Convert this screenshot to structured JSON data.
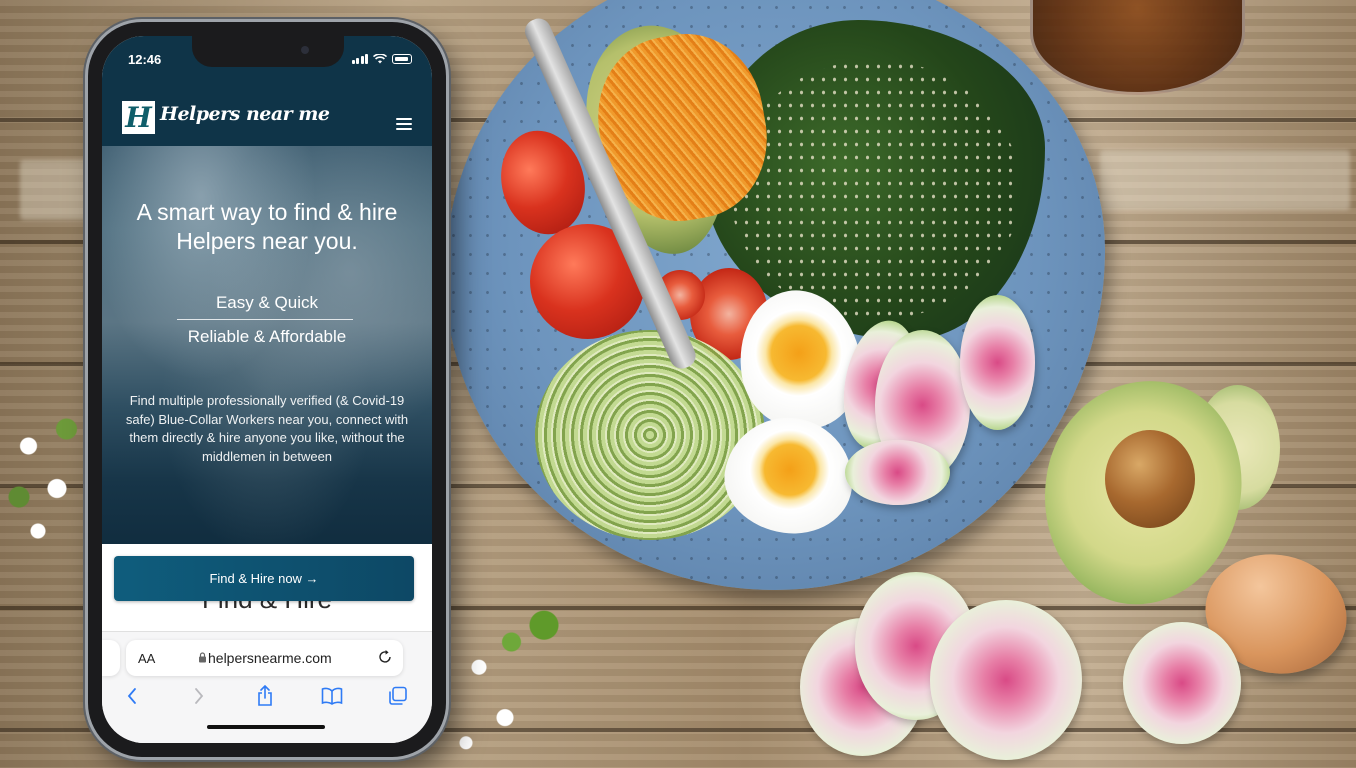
{
  "status_bar": {
    "time": "12:46"
  },
  "site": {
    "logo_letter": "H",
    "logo_text": "Helpers near me",
    "brand_color": "#0f3448"
  },
  "hero": {
    "title": "A smart way to find & hire Helpers near you.",
    "point_1": "Easy & Quick",
    "point_2": "Reliable & Affordable",
    "description": "Find multiple professionally verified (& Covid-19 safe) Blue-Collar Workers near you, connect with them directly & hire anyone you like, without the middlemen in between"
  },
  "cta": {
    "button_label": "Find & Hire now →",
    "heading_peek": "Find & Hire",
    "button_color": "#0f5d7d"
  },
  "browser": {
    "text_size_label": "AA",
    "url": "helpersnearme.com",
    "icons": [
      "back-icon",
      "forward-icon",
      "share-icon",
      "bookmarks-icon",
      "tabs-icon",
      "reload-icon",
      "lock-icon"
    ]
  }
}
